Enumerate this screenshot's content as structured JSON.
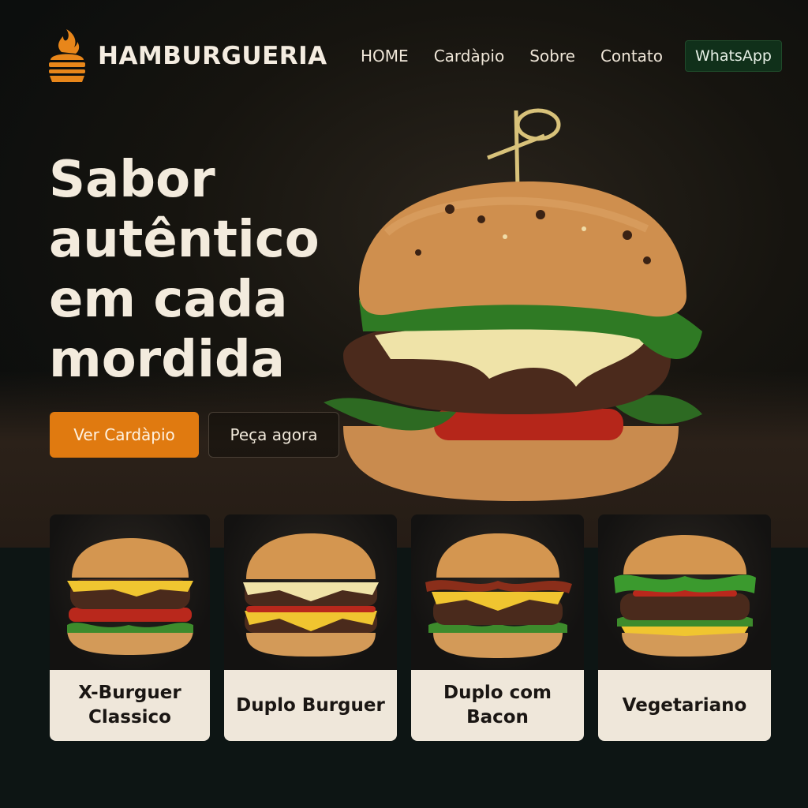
{
  "header": {
    "brand": "HAMBURGUERIA",
    "nav": [
      "HOME",
      "Cardàpio",
      "Sobre",
      "Contato"
    ],
    "whatsapp_label": "WhatsApp"
  },
  "hero": {
    "headline_lines": [
      "Sabor",
      "autêntico",
      "em cada",
      "mordida"
    ],
    "primary_label": "Ver Cardàpio",
    "secondary_label": "Peça agora"
  },
  "menu": [
    {
      "name": "X-Burguer Classico"
    },
    {
      "name": "Duplo Burguer"
    },
    {
      "name": "Duplo com Bacon"
    },
    {
      "name": "Vegetariano"
    }
  ],
  "colors": {
    "accent": "#e07a10",
    "background": "#0e1312",
    "card_label": "#efe7da",
    "whatsapp": "#10301a"
  },
  "icons": {
    "logo": "flame-burger-icon"
  }
}
